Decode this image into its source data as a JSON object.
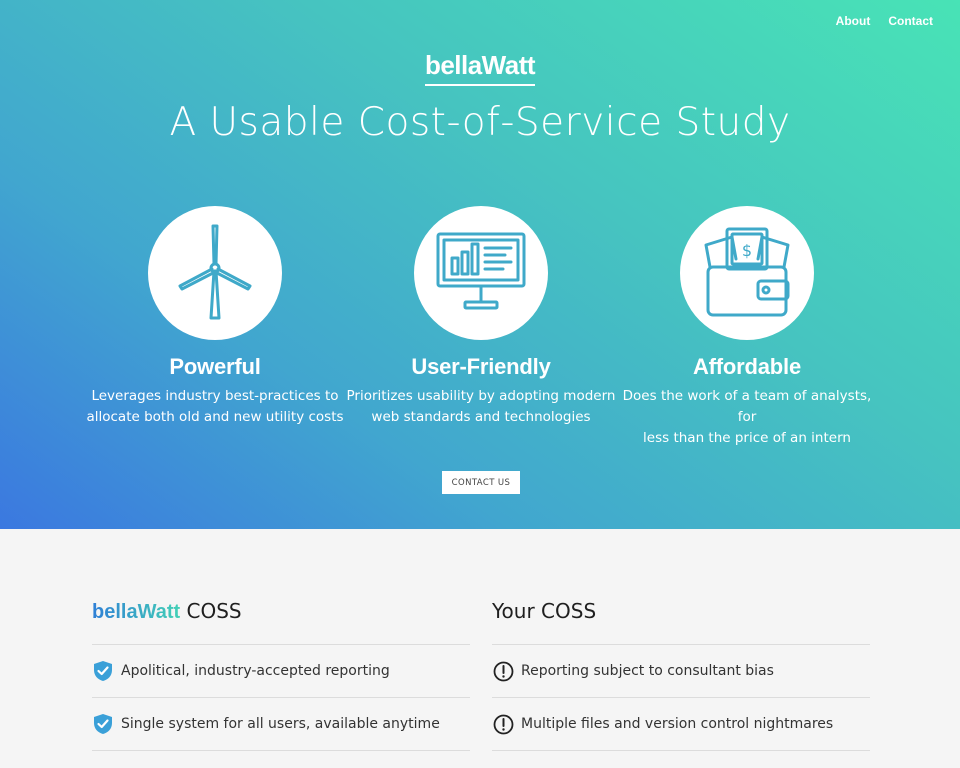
{
  "nav": {
    "about": "About",
    "contact": "Contact"
  },
  "brand": {
    "logo": "bellaWatt"
  },
  "hero": {
    "headline": "A Usable Cost-of-Service Study"
  },
  "features": [
    {
      "icon": "wind-turbine-icon",
      "title": "Powerful",
      "line1": "Leverages industry best-practices to",
      "line2": "allocate both old and new utility costs"
    },
    {
      "icon": "presentation-chart-icon",
      "title": "User-Friendly",
      "line1": "Prioritizes usability by adopting modern",
      "line2": "web standards and technologies"
    },
    {
      "icon": "wallet-icon",
      "title": "Affordable",
      "line1": "Does the work of a team of analysts, for",
      "line2": "less than the price of an intern"
    }
  ],
  "cta": {
    "label": "CONTACT US"
  },
  "comparison": {
    "left": {
      "brand": "bellaWatt",
      "title": "COSS",
      "items": [
        "Apolitical, industry-accepted reporting",
        "Single system for all users, available anytime"
      ]
    },
    "right": {
      "title": "Your COSS",
      "items": [
        "Reporting subject to consultant bias",
        "Multiple files and version control nightmares"
      ]
    }
  },
  "colors": {
    "accent_teal": "#3fa9c9",
    "gradient_start": "#48e3b6",
    "gradient_end": "#3b78e0",
    "check_blue": "#3aa0d8"
  }
}
